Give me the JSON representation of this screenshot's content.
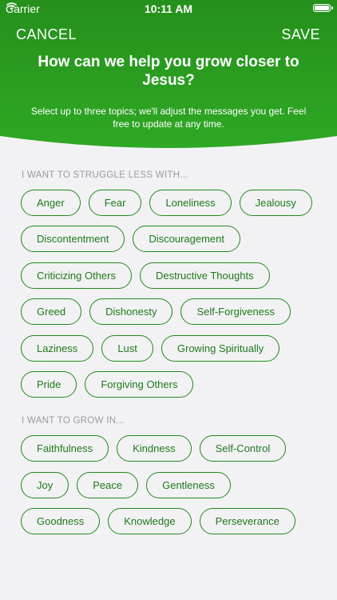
{
  "status": {
    "carrier": "Carrier",
    "time": "10:11 AM"
  },
  "nav": {
    "cancel": "CANCEL",
    "save": "SAVE"
  },
  "header": {
    "title": "How can we help you grow closer to Jesus?",
    "subtitle": "Select up to three topics; we'll adjust the messages you get. Feel free to update at any time."
  },
  "sections": [
    {
      "label": "I WANT TO STRUGGLE LESS WITH...",
      "rows": [
        [
          "Anger",
          "Fear",
          "Loneliness",
          "Jealousy"
        ],
        [
          "Discontentment",
          "Discouragement"
        ],
        [
          "Criticizing Others",
          "Destructive Thoughts"
        ],
        [
          "Greed",
          "Dishonesty",
          "Self-Forgiveness"
        ],
        [
          "Laziness",
          "Lust",
          "Growing Spiritually"
        ],
        [
          "Pride",
          "Forgiving Others"
        ]
      ]
    },
    {
      "label": "I WANT TO GROW IN...",
      "rows": [
        [
          "Faithfulness",
          "Kindness",
          "Self-Control"
        ],
        [
          "Joy",
          "Peace",
          "Gentleness"
        ],
        [
          "Goodness",
          "Knowledge",
          "Perseverance"
        ]
      ]
    }
  ],
  "colors": {
    "header_top": "#1f8a1a",
    "header_bottom": "#2eaa22",
    "chip_border": "#1f8a1a",
    "background": "#f2f2f4"
  }
}
